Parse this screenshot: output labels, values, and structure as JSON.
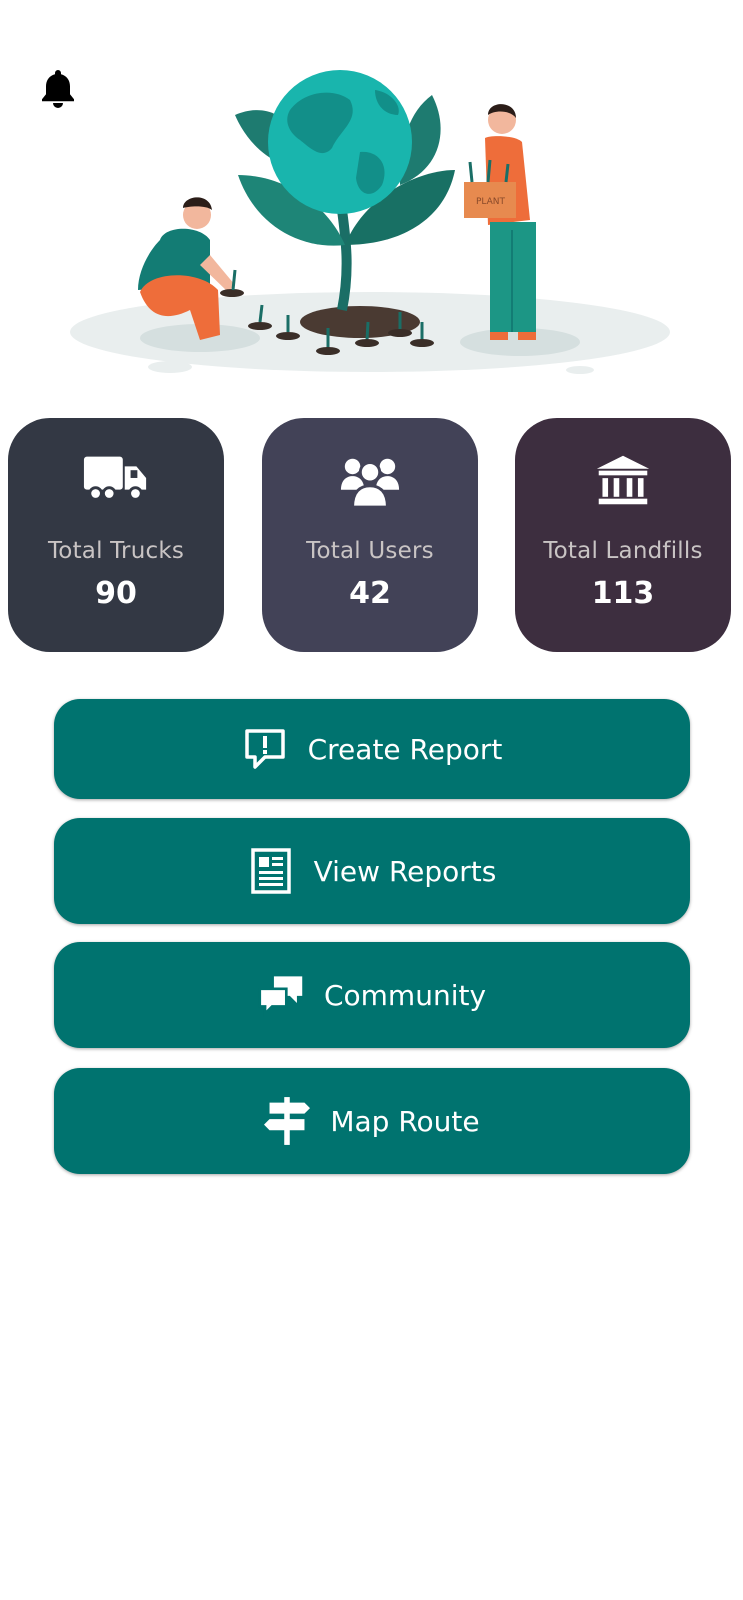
{
  "header": {
    "notification_icon": "bell-icon"
  },
  "hero": {
    "illustration": "people-planting-globe-tree",
    "box_text": "PLANT"
  },
  "stats": [
    {
      "id": "trucks",
      "icon": "truck-icon",
      "label": "Total Trucks",
      "value": "90"
    },
    {
      "id": "users",
      "icon": "users-icon",
      "label": "Total Users",
      "value": "42"
    },
    {
      "id": "landfills",
      "icon": "landfill-building-icon",
      "label": "Total Landfills",
      "value": "113"
    }
  ],
  "actions": [
    {
      "icon": "report-alert-icon",
      "label": "Create Report"
    },
    {
      "icon": "newspaper-icon",
      "label": "View Reports"
    },
    {
      "icon": "chat-bubbles-icon",
      "label": "Community"
    },
    {
      "icon": "signpost-icon",
      "label": "Map Route"
    }
  ],
  "colors": {
    "accent": "#00736f",
    "trucks_card": "#333844",
    "users_card": "#424257",
    "landfills_card": "#3d2e3f",
    "card_label": "#c9c4c4"
  }
}
